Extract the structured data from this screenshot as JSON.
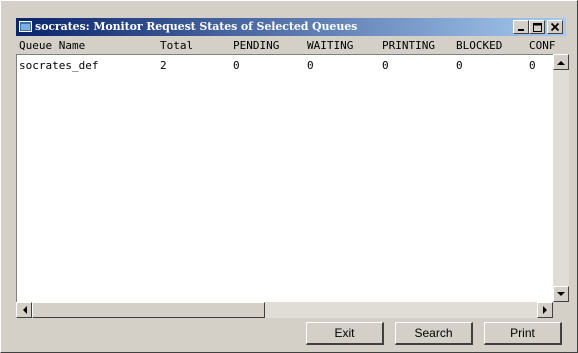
{
  "window": {
    "title": "socrates: Monitor Request States of Selected Queues",
    "controls": {
      "minimize": "_",
      "maximize": "□",
      "close": "×"
    }
  },
  "table": {
    "columns": [
      "Queue Name",
      "Total",
      "PENDING",
      "WAITING",
      "PRINTING",
      "BLOCKED",
      "CONF"
    ],
    "rows": [
      [
        "socrates_def",
        "2",
        "0",
        "0",
        "0",
        "0",
        "0"
      ]
    ]
  },
  "buttons": {
    "exit": "Exit",
    "search": "Search",
    "print": "Print"
  },
  "icons": {
    "app": "app-window-icon",
    "scroll_up": "scroll-up-arrow-icon",
    "scroll_down": "scroll-down-arrow-icon",
    "scroll_left": "scroll-left-arrow-icon",
    "scroll_right": "scroll-right-arrow-icon"
  }
}
